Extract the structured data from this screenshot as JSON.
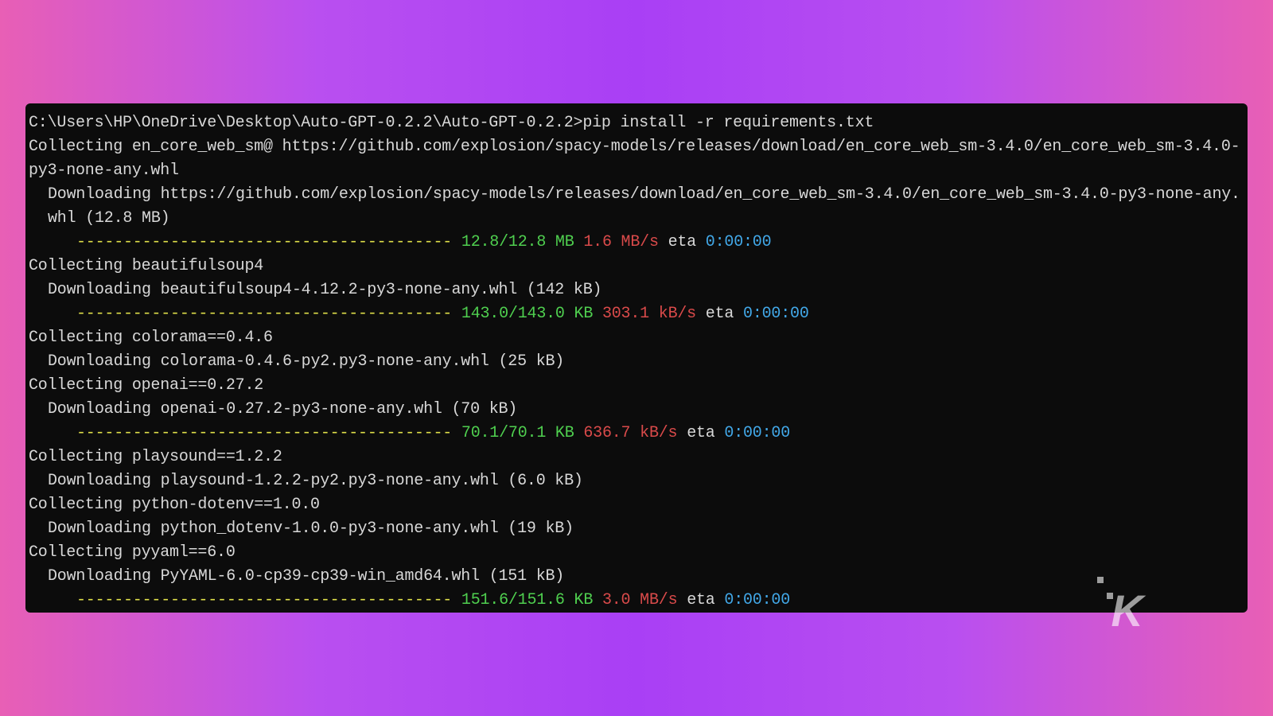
{
  "terminal": {
    "prompt": "C:\\Users\\HP\\OneDrive\\Desktop\\Auto-GPT-0.2.2\\Auto-GPT-0.2.2>pip install -r requirements.txt",
    "lines": [
      {
        "type": "text",
        "indent": 0,
        "text": "Collecting en_core_web_sm@ https://github.com/explosion/spacy-models/releases/download/en_core_web_sm-3.4.0/en_core_web_sm-3.4.0-py3-none-any.whl"
      },
      {
        "type": "text",
        "indent": 1,
        "text": "Downloading https://github.com/explosion/spacy-models/releases/download/en_core_web_sm-3.4.0/en_core_web_sm-3.4.0-py3-none-any.whl (12.8 MB)"
      },
      {
        "type": "progress",
        "bar": "----------------------------------------",
        "size": "12.8/12.8 MB",
        "speed": "1.6 MB/s",
        "eta_label": "eta",
        "eta_time": "0:00:00"
      },
      {
        "type": "text",
        "indent": 0,
        "text": "Collecting beautifulsoup4"
      },
      {
        "type": "text",
        "indent": 1,
        "text": "Downloading beautifulsoup4-4.12.2-py3-none-any.whl (142 kB)"
      },
      {
        "type": "progress",
        "bar": "----------------------------------------",
        "size": "143.0/143.0 KB",
        "speed": "303.1 kB/s",
        "eta_label": "eta",
        "eta_time": "0:00:00"
      },
      {
        "type": "text",
        "indent": 0,
        "text": "Collecting colorama==0.4.6"
      },
      {
        "type": "text",
        "indent": 1,
        "text": "Downloading colorama-0.4.6-py2.py3-none-any.whl (25 kB)"
      },
      {
        "type": "text",
        "indent": 0,
        "text": "Collecting openai==0.27.2"
      },
      {
        "type": "text",
        "indent": 1,
        "text": "Downloading openai-0.27.2-py3-none-any.whl (70 kB)"
      },
      {
        "type": "progress",
        "bar": "----------------------------------------",
        "size": "70.1/70.1 KB",
        "speed": "636.7 kB/s",
        "eta_label": "eta",
        "eta_time": "0:00:00"
      },
      {
        "type": "text",
        "indent": 0,
        "text": "Collecting playsound==1.2.2"
      },
      {
        "type": "text",
        "indent": 1,
        "text": "Downloading playsound-1.2.2-py2.py3-none-any.whl (6.0 kB)"
      },
      {
        "type": "text",
        "indent": 0,
        "text": "Collecting python-dotenv==1.0.0"
      },
      {
        "type": "text",
        "indent": 1,
        "text": "Downloading python_dotenv-1.0.0-py3-none-any.whl (19 kB)"
      },
      {
        "type": "text",
        "indent": 0,
        "text": "Collecting pyyaml==6.0"
      },
      {
        "type": "text",
        "indent": 1,
        "text": "Downloading PyYAML-6.0-cp39-cp39-win_amd64.whl (151 kB)"
      },
      {
        "type": "progress",
        "bar": "----------------------------------------",
        "size": "151.6/151.6 KB",
        "speed": "3.0 MB/s",
        "eta_label": "eta",
        "eta_time": "0:00:00"
      }
    ]
  },
  "watermark": "K"
}
